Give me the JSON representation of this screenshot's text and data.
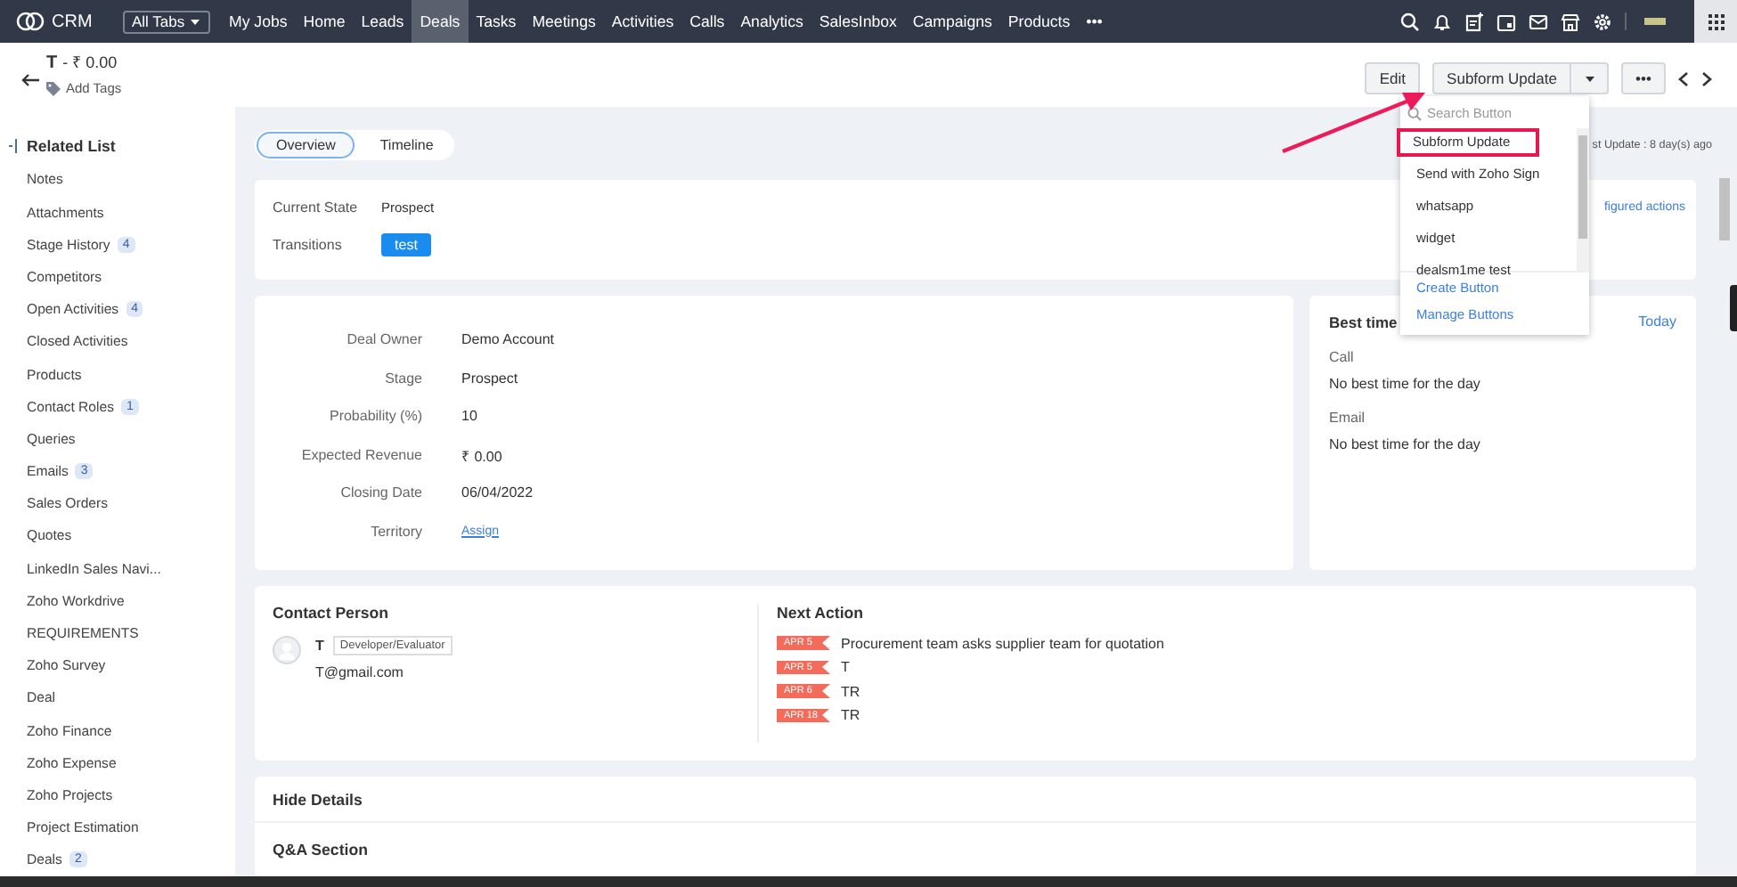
{
  "topbar": {
    "logo": "CRM",
    "all_tabs": "All Tabs",
    "nav": [
      {
        "label": "My Jobs",
        "selected": false
      },
      {
        "label": "Home",
        "selected": false
      },
      {
        "label": "Leads",
        "selected": false
      },
      {
        "label": "Deals",
        "selected": true
      },
      {
        "label": "Tasks",
        "selected": false
      },
      {
        "label": "Meetings",
        "selected": false
      },
      {
        "label": "Activities",
        "selected": false
      },
      {
        "label": "Calls",
        "selected": false
      },
      {
        "label": "Analytics",
        "selected": false
      },
      {
        "label": "SalesInbox",
        "selected": false
      },
      {
        "label": "Campaigns",
        "selected": false
      },
      {
        "label": "Products",
        "selected": false
      }
    ],
    "more": "•••"
  },
  "record": {
    "name": "T",
    "amount": "- ₹ 0.00",
    "add_tags": "Add Tags"
  },
  "actions": {
    "edit": "Edit",
    "split": "Subform Update",
    "more": "•••"
  },
  "dropdown": {
    "placeholder": "Search Button",
    "items": [
      {
        "label": "Subform Update",
        "highlighted": true
      },
      {
        "label": "Send with Zoho Sign",
        "highlighted": false
      },
      {
        "label": "whatsapp",
        "highlighted": false
      },
      {
        "label": "widget",
        "highlighted": false
      },
      {
        "label": "dealsm1me test",
        "highlighted": false
      }
    ],
    "footer": [
      "Create Button",
      "Manage Buttons"
    ]
  },
  "sidebar": {
    "title": "Related List",
    "items": [
      {
        "label": "Notes"
      },
      {
        "label": "Attachments"
      },
      {
        "label": "Stage History",
        "count": "4"
      },
      {
        "label": "Competitors"
      },
      {
        "label": "Open Activities",
        "count": "4"
      },
      {
        "label": "Closed Activities"
      },
      {
        "label": "Products"
      },
      {
        "label": "Contact Roles",
        "count": "1"
      },
      {
        "label": "Queries"
      },
      {
        "label": "Emails",
        "count": "3"
      },
      {
        "label": "Sales Orders"
      },
      {
        "label": "Quotes"
      },
      {
        "label": "LinkedIn Sales Navi..."
      },
      {
        "label": "Zoho Workdrive"
      },
      {
        "label": "REQUIREMENTS"
      },
      {
        "label": "Zoho Survey"
      },
      {
        "label": "Deal"
      },
      {
        "label": "Zoho Finance"
      },
      {
        "label": "Zoho Expense"
      },
      {
        "label": "Zoho Projects"
      },
      {
        "label": "Project Estimation"
      },
      {
        "label": "Deals",
        "count": "2"
      }
    ]
  },
  "tabs": [
    {
      "label": "Overview",
      "selected": true
    },
    {
      "label": "Timeline",
      "selected": false
    }
  ],
  "last_update": "st Update : 8 day(s) ago",
  "blueprint": {
    "current_state_label": "Current State",
    "current_state": "Prospect",
    "transitions_label": "Transitions",
    "transition": "test",
    "link": "figured actions"
  },
  "fields": [
    {
      "label": "Deal Owner",
      "value": "Demo Account",
      "kind": "text"
    },
    {
      "label": "Stage",
      "value": "Prospect",
      "kind": "text"
    },
    {
      "label": "Probability (%)",
      "value": "10",
      "kind": "text"
    },
    {
      "label": "Expected Revenue",
      "value": "₹ 0.00",
      "kind": "text"
    },
    {
      "label": "Closing Date",
      "value": "06/04/2022",
      "kind": "text"
    },
    {
      "label": "Territory",
      "value": "Assign",
      "kind": "link"
    }
  ],
  "best_time": {
    "title": "Best time",
    "today": "Today",
    "sections": [
      {
        "label": "Call",
        "text": "No best time for the day"
      },
      {
        "label": "Email",
        "text": "No best time for the day"
      }
    ]
  },
  "contact": {
    "title": "Contact Person",
    "name": "T",
    "role": "Developer/Evaluator",
    "email": "T@gmail.com"
  },
  "next_action": {
    "title": "Next Action",
    "items": [
      {
        "date": "APR 5",
        "text": "Procurement team asks supplier team for quotation"
      },
      {
        "date": "APR 5",
        "text": "T"
      },
      {
        "date": "APR 6",
        "text": "TR"
      },
      {
        "date": "APR 18",
        "text": "TR"
      }
    ]
  },
  "details": {
    "title": "Hide Details",
    "section": "Q&A Section"
  }
}
